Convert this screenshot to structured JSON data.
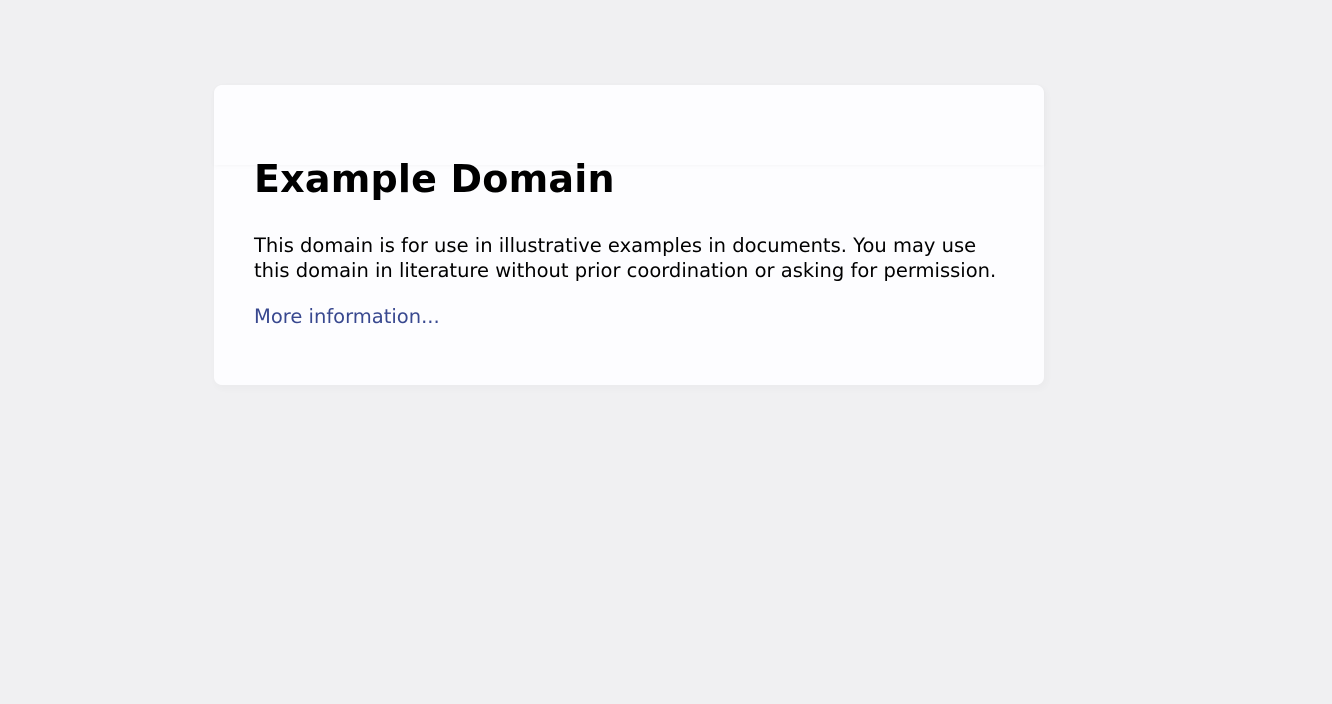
{
  "page": {
    "title": "Example Domain",
    "description": "This domain is for use in illustrative examples in documents. You may use this domain in literature without prior coordination or asking for permission.",
    "link_text": "More information..."
  },
  "colors": {
    "background": "#f0f0f2",
    "card": "#fdfdff",
    "text": "#000000",
    "link": "#38488f"
  }
}
